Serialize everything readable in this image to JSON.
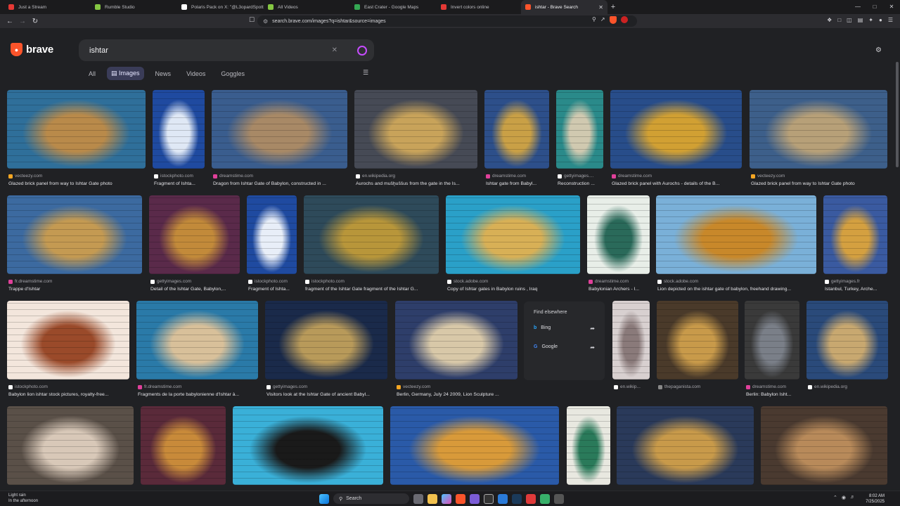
{
  "tabs": [
    {
      "title": "Just a Stream",
      "color": "#e53935"
    },
    {
      "title": "Rumble Studio",
      "color": "#85c742"
    },
    {
      "title": "Polaris Pack on X: \"@L3opardSpott3...",
      "color": "#ffffff"
    },
    {
      "title": "All Videos",
      "color": "#85c742"
    },
    {
      "title": "East Crater - Google Maps",
      "color": "#34a853"
    },
    {
      "title": "Invert colors online",
      "color": "#e53935"
    },
    {
      "title": "ishtar - Brave Search",
      "color": "#fb542b",
      "active": true
    }
  ],
  "toolbar": {
    "url": "search.brave.com/images?q=ishtar&source=images"
  },
  "brand": {
    "name": "brave",
    "accent": "#fb542b"
  },
  "search": {
    "query": "ishtar"
  },
  "nav": {
    "all": "All",
    "images": "Images",
    "news": "News",
    "videos": "Videos",
    "goggles": "Goggles"
  },
  "results": [
    {
      "source": "vecteezy.com",
      "title": "Glazed brick panel from way to Ishtar Gate photo",
      "sc": "#f5a623",
      "c1": "#2f6f9a",
      "c2": "#b98a4a"
    },
    {
      "source": "istockphoto.com",
      "title": "Fragment of Ishta...",
      "sc": "#ffffff",
      "c1": "#1f4aa0",
      "c2": "#dfe8f5"
    },
    {
      "source": "dreamstime.com",
      "title": "Dragon from Ishtar Gate of Babylon, constructed in ...",
      "sc": "#e0409a",
      "c1": "#3a5d8e",
      "c2": "#a88966"
    },
    {
      "source": "en.wikipedia.org",
      "title": "Aurochs and mušḫuššus from the gate in the Is...",
      "sc": "#ffffff",
      "c1": "#464a55",
      "c2": "#c8a35a"
    },
    {
      "source": "dreamstime.com",
      "title": "Ishtar gate from Babyl...",
      "sc": "#e0409a",
      "c1": "#2d4f8a",
      "c2": "#c9a046"
    },
    {
      "source": "gettyimages....",
      "title": "Reconstruction ...",
      "sc": "#ffffff",
      "c1": "#2a8a8a",
      "c2": "#d0c9b0"
    },
    {
      "source": "dreamstime.com",
      "title": "Glazed brick panel with Aurochs - details of the B...",
      "sc": "#e0409a",
      "c1": "#284d8a",
      "c2": "#d1a033"
    },
    {
      "source": "vecteezy.com",
      "title": "Glazed brick panel from way to Ishtar Gate photo",
      "sc": "#f5a623",
      "c1": "#3d5f8a",
      "c2": "#b7a078"
    },
    {
      "source": "fr.dreamstime.com",
      "title": "Trappe d'Ishtar",
      "sc": "#e0409a",
      "c1": "#3c6aa0",
      "c2": "#c49a52"
    },
    {
      "source": "gettyimages.com",
      "title": "Detail of the Ishtar Gate, Babylon,...",
      "sc": "#ffffff",
      "c1": "#5a2a4a",
      "c2": "#c28a3a"
    },
    {
      "source": "istockphoto.com",
      "title": "Fragment of Ishta...",
      "sc": "#ffffff",
      "c1": "#1f4aa0",
      "c2": "#e8eef8"
    },
    {
      "source": "istockphoto.com",
      "title": "fragment of the Ishtar Gate fragment of the Ishtar G...",
      "sc": "#ffffff",
      "c1": "#2e4a5a",
      "c2": "#b8963a"
    },
    {
      "source": "stock.adobe.com",
      "title": "Copy of Ishtar gates in Babylon ruins , Iraq",
      "sc": "#ffffff",
      "c1": "#2aa0c8",
      "c2": "#d8b056"
    },
    {
      "source": "dreamstime.com",
      "title": "Babylonian Archers - I...",
      "sc": "#e0409a",
      "c1": "#e8eee8",
      "c2": "#2a6a5a"
    },
    {
      "source": "stock.adobe.com",
      "title": "Lion depicted on the ishtar gate of babylon, freehand drawing...",
      "sc": "#ffffff",
      "c1": "#7ab0d8",
      "c2": "#c8882a"
    },
    {
      "source": "gettyimages.fr",
      "title": "Istanbul, Turkey, Arche...",
      "sc": "#ffffff",
      "c1": "#3a5aa0",
      "c2": "#d4a040"
    },
    {
      "source": "istockphoto.com",
      "title": "Babylon lion ishtar stock pictures, royalty-free...",
      "sc": "#ffffff",
      "c1": "#f3e6dc",
      "c2": "#9a4a2a"
    },
    {
      "source": "fr.dreamstime.com",
      "title": "Fragments de la porte babylonienne d'Ishtar à...",
      "sc": "#e0409a",
      "c1": "#2a7aa8",
      "c2": "#d8c09a"
    },
    {
      "source": "gettyimages.com",
      "title": "Visitors look at the Ishtar Gate of ancient Babyl...",
      "sc": "#ffffff",
      "c1": "#1a2a4a",
      "c2": "#b89a5a"
    },
    {
      "source": "vecteezy.com",
      "title": "Berlin, Germany, July 24 2009, Lion Sculpture ...",
      "sc": "#f5a623",
      "c1": "#2e3e6a",
      "c2": "#d8c8a8"
    },
    {
      "source": "en.wikip...",
      "title": "",
      "sc": "#ffffff",
      "c1": "#d8d0d0",
      "c2": "#8a7a7a"
    },
    {
      "source": "thepaganista.com",
      "title": "",
      "sc": "#888888",
      "c1": "#4a3a2a",
      "c2": "#c89a4a"
    },
    {
      "source": "dreamstime.com",
      "title": "Berlin: Babylon Isht...",
      "sc": "#e0409a",
      "c1": "#3a3a3a",
      "c2": "#7a7f88"
    },
    {
      "source": "en.wikipedia.org",
      "title": "",
      "sc": "#ffffff",
      "c1": "#2a4a7a",
      "c2": "#c8a870"
    },
    {
      "source": "",
      "title": "",
      "sc": "#000000",
      "c1": "#5a5048",
      "c2": "#d8c8b8"
    },
    {
      "source": "",
      "title": "",
      "sc": "#000000",
      "c1": "#5a2a3a",
      "c2": "#c88a3a"
    },
    {
      "source": "",
      "title": "",
      "sc": "#000000",
      "c1": "#3ab0d8",
      "c2": "#1a1a1a"
    },
    {
      "source": "",
      "title": "",
      "sc": "#000000",
      "c1": "#2a5aa8",
      "c2": "#d89a3a"
    },
    {
      "source": "",
      "title": "",
      "sc": "#000000",
      "c1": "#e8e8e0",
      "c2": "#2a7a5a"
    },
    {
      "source": "",
      "title": "",
      "sc": "#000000",
      "c1": "#2a3a5a",
      "c2": "#c89a4a"
    },
    {
      "source": "",
      "title": "",
      "sc": "#000000",
      "c1": "#4a3a30",
      "c2": "#b88a5a"
    }
  ],
  "find_elsewhere": {
    "heading": "Find elsewhere",
    "items": [
      "Bing",
      "Google"
    ]
  },
  "taskbar": {
    "weather_line1": "Light rain",
    "weather_line2": "In the afternoon",
    "search": "Search",
    "time": "8:02 AM",
    "date": "7/25/2025"
  }
}
